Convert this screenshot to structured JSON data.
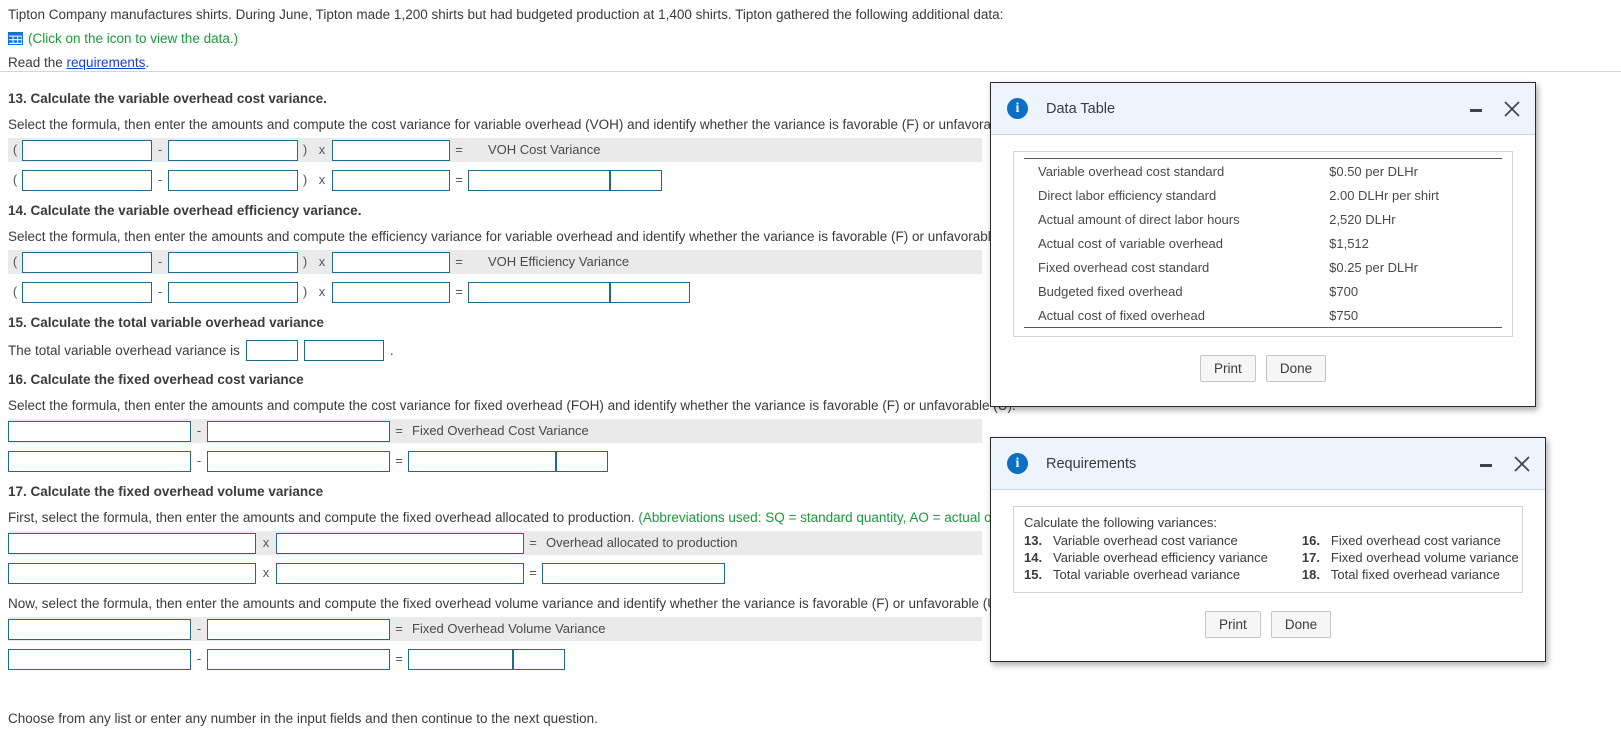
{
  "prompt": {
    "intro": "Tipton Company manufactures shirts. During June, Tipton made 1,200 shirts but had budgeted production at 1,400 shirts. Tipton gathered the following additional data:",
    "data_link": "(Click on the icon to view the data.)",
    "data_icon": "grid-table-icon",
    "read_prefix": "Read the ",
    "read_link": "requirements",
    "read_suffix": "."
  },
  "questions": [
    {
      "number": "13.",
      "title": " Calculate the variable overhead cost variance.",
      "instruction": "Select the formula, then enter the amounts and compute the cost variance for variable overhead (VOH) and identify whether the variance is favorable (F) or unfavorable (U).",
      "result_label": "VOH Cost Variance"
    },
    {
      "number": "14.",
      "title": " Calculate the variable overhead efficiency variance.",
      "instruction": "Select the formula, then enter the amounts and compute the efficiency variance for variable overhead and identify whether the variance is favorable (F) or unfavorable (U).",
      "result_label": "VOH Efficiency Variance"
    },
    {
      "number": "15.",
      "title": " Calculate the total variable overhead variance",
      "sentence_prefix": "The total variable overhead variance is",
      "sentence_suffix": "."
    },
    {
      "number": "16.",
      "title": " Calculate the fixed overhead cost variance",
      "instruction": "Select the formula, then enter the amounts and compute the cost variance for fixed overhead (FOH) and identify whether the variance is favorable (F) or unfavorable (U).",
      "result_label": "Fixed Overhead Cost Variance"
    },
    {
      "number": "17.",
      "title": " Calculate the fixed overhead volume variance",
      "instruction_a": "First, select the formula, then enter the amounts and compute the fixed overhead allocated to production. ",
      "instruction_a_note": "(Abbreviations used: SQ = standard quantity, AO = actual output.)",
      "result_label_a": "Overhead allocated to production",
      "instruction_b": "Now, select the formula, then enter the amounts and compute the fixed overhead volume variance and identify whether the variance is favorable (F) or unfavorable (U).",
      "result_label_b": "Fixed Overhead Volume Variance"
    }
  ],
  "operators": {
    "open_paren": "(",
    "close_paren": ")",
    "minus": "-",
    "times": "x",
    "equals": "="
  },
  "footer": "Choose from any list or enter any number in the input fields and then continue to the next question.",
  "input_value": "",
  "dialogs": {
    "data_table": {
      "title": "Data Table",
      "icon": "info-icon",
      "minimize_icon": "minimize-icon",
      "close_icon": "close-icon",
      "rows": [
        {
          "label": "Variable overhead cost standard",
          "value": "$0.50 per DLHr"
        },
        {
          "label": "Direct labor efficiency standard",
          "value": "2.00 DLHr per shirt"
        },
        {
          "label": "Actual amount of direct labor hours",
          "value": "2,520 DLHr"
        },
        {
          "label": "Actual cost of variable overhead",
          "value": "$1,512"
        },
        {
          "label": "Fixed overhead cost standard",
          "value": "$0.25 per DLHr"
        },
        {
          "label": "Budgeted fixed overhead",
          "value": "$700"
        },
        {
          "label": "Actual cost of fixed overhead",
          "value": "$750"
        }
      ],
      "print_label": "Print",
      "done_label": "Done"
    },
    "requirements": {
      "title": "Requirements",
      "icon": "info-icon",
      "minimize_icon": "minimize-icon",
      "close_icon": "close-icon",
      "heading": "Calculate the following variances:",
      "left_items": [
        {
          "num": "13.",
          "text": "Variable overhead cost variance"
        },
        {
          "num": "14.",
          "text": "Variable overhead efficiency variance"
        },
        {
          "num": "15.",
          "text": "Total variable overhead variance"
        }
      ],
      "right_items": [
        {
          "num": "16.",
          "text": "Fixed overhead cost variance"
        },
        {
          "num": "17.",
          "text": "Fixed overhead volume variance"
        },
        {
          "num": "18.",
          "text": "Total fixed overhead variance"
        }
      ],
      "print_label": "Print",
      "done_label": "Done"
    }
  },
  "colors": {
    "input_border": "#1d6e8e",
    "green_text": "#1a9a3c",
    "link_blue": "#1a3fd0",
    "info_blue": "#0d6ec4",
    "shaded_row": "#eaeaea"
  }
}
